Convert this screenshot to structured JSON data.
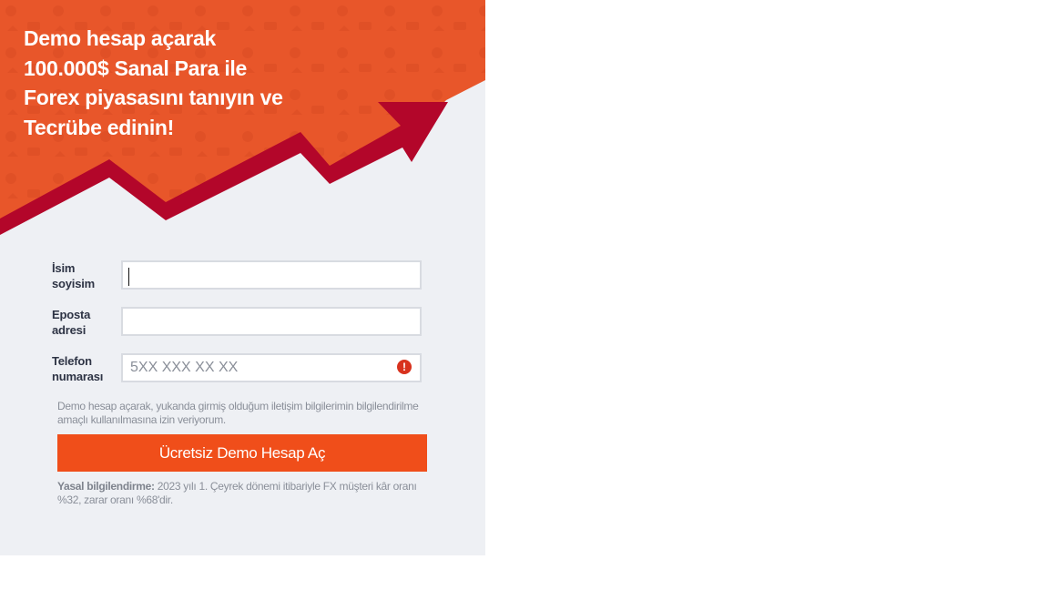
{
  "hero": {
    "headline_lines": [
      "Demo hesap açarak",
      "100.000$ Sanal Para ile",
      "Forex piyasasını tanıyın ve",
      "Tecrübe edinin!"
    ],
    "colors": {
      "orange": "#e8562a",
      "arrow": "#b3062a"
    }
  },
  "form": {
    "name_label": "İsim soyisim",
    "name_value": "",
    "email_label": "Eposta adresi",
    "email_value": "",
    "phone_label": "Telefon numarası",
    "phone_placeholder": "5XX XXX XX XX",
    "phone_value": "",
    "phone_error_icon": "alert-circle-icon",
    "consent_text": "Demo hesap açarak, yukanda girmiş olduğum iletişim bilgilerimin bilgilendirilme amaçlı kullanılmasına izin veriyorum.",
    "submit_label": "Ücretsiz Demo Hesap Aç",
    "legal_title": "Yasal bilgilendirme:",
    "legal_text": " 2023 yılı 1. Çeyrek dönemi itibariyle FX müşteri kâr oranı %32, zarar oranı %68'dir."
  },
  "colors": {
    "button": "#f04e1a",
    "panel_bg": "#eef0f4",
    "error": "#d8321e"
  }
}
